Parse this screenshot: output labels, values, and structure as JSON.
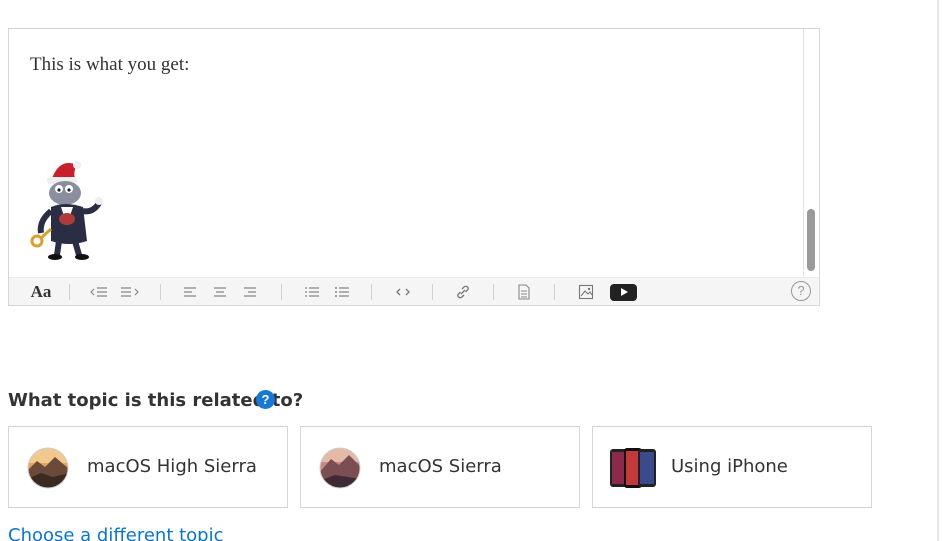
{
  "editor": {
    "body_text": "This is what you get:",
    "toolbar": {
      "font_label": "Aa",
      "help_label": "?"
    }
  },
  "topic_section": {
    "question": "What topic is this related to?",
    "help_label": "?",
    "cards": [
      {
        "label": "macOS High Sierra",
        "icon": "macos-high-sierra-icon"
      },
      {
        "label": "macOS Sierra",
        "icon": "macos-sierra-icon"
      },
      {
        "label": "Using iPhone",
        "icon": "iphone-icon"
      }
    ],
    "change_link": "Choose a different topic"
  },
  "colors": {
    "link": "#0a74d6",
    "help_badge": "#1779d6",
    "toolbar_bg": "#f5f5f5"
  }
}
